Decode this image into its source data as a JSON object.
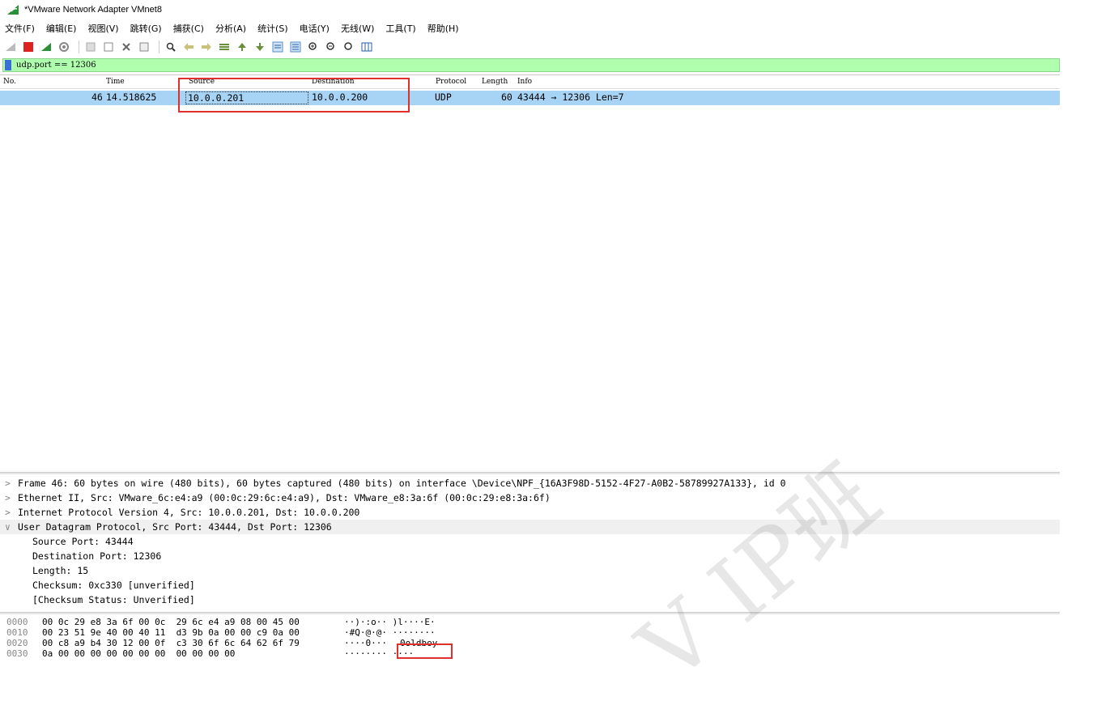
{
  "window": {
    "title": "*VMware Network Adapter VMnet8"
  },
  "menu": [
    "文件(F)",
    "编辑(E)",
    "视图(V)",
    "跳转(G)",
    "捕获(C)",
    "分析(A)",
    "统计(S)",
    "电话(Y)",
    "无线(W)",
    "工具(T)",
    "帮助(H)"
  ],
  "filter": {
    "value": "udp.port == 12306"
  },
  "columns": {
    "no": "No.",
    "time": "Time",
    "source": "Source",
    "destination": "Destination",
    "protocol": "Protocol",
    "length": "Length",
    "info": "Info"
  },
  "packet": {
    "no": "46",
    "time": "14.518625",
    "source": "10.0.0.201",
    "destination": "10.0.0.200",
    "protocol": "UDP",
    "length": "60",
    "info": "43444 → 12306 Len=7"
  },
  "details": [
    {
      "text": "Frame 46: 60 bytes on wire (480 bits), 60 bytes captured (480 bits) on interface \\Device\\NPF_{16A3F98D-5152-4F27-A0B2-58789927A133}, id 0"
    },
    {
      "text": "Ethernet II, Src: VMware_6c:e4:a9 (00:0c:29:6c:e4:a9), Dst: VMware_e8:3a:6f (00:0c:29:e8:3a:6f)"
    },
    {
      "text": "Internet Protocol Version 4, Src: 10.0.0.201, Dst: 10.0.0.200"
    },
    {
      "text": "User Datagram Protocol, Src Port: 43444, Dst Port: 12306"
    }
  ],
  "udp_children": [
    "Source Port: 43444",
    "Destination Port: 12306",
    "Length: 15",
    "Checksum: 0xc330 [unverified]",
    "[Checksum Status: Unverified]"
  ],
  "hex": [
    {
      "off": "0000",
      "bytes": "00 0c 29 e8 3a 6f 00 0c  29 6c e4 a9 08 00 45 00",
      "ascii": "··)·:o·· )l····E·"
    },
    {
      "off": "0010",
      "bytes": "00 23 51 9e 40 00 40 11  d3 9b 0a 00 00 c9 0a 00",
      "ascii": "·#Q·@·@· ········"
    },
    {
      "off": "0020",
      "bytes": "00 c8 a9 b4 30 12 00 0f  c3 30 6f 6c 64 62 6f 79",
      "ascii": "····0··· ",
      "ascii_hl": "0oldboy"
    },
    {
      "off": "0030",
      "bytes": "0a 00 00 00 00 00 00 00  00 00 00 00",
      "ascii": "········ ····"
    }
  ],
  "watermark": "V IP班",
  "colors": {
    "filter_bg": "#afffaf",
    "selected_row": "#a7d3f5",
    "highlight_box": "#e0302e"
  }
}
